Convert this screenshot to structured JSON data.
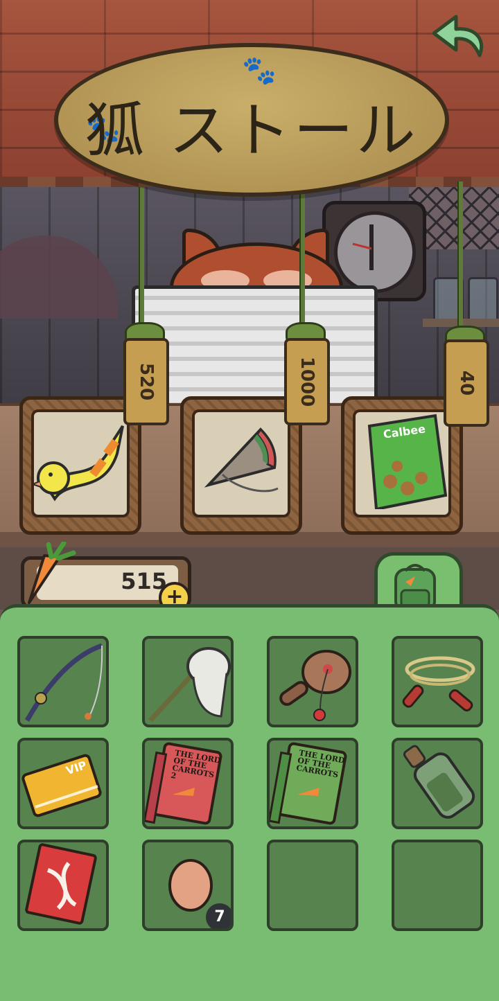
{
  "shop": {
    "sign_title": "狐 ストール",
    "prices": [
      "520",
      "1000",
      "40"
    ],
    "items": [
      {
        "name": "swim ring",
        "icon": "duck-float-icon"
      },
      {
        "name": "spinning top",
        "icon": "spinning-top-icon"
      },
      {
        "name": "snack bag",
        "icon": "snack-bag-icon",
        "brand": "Calbee"
      }
    ]
  },
  "wallet": {
    "carrots": "515",
    "plus": "+"
  },
  "inventory": {
    "slots": [
      {
        "icon": "fishing-rod-icon"
      },
      {
        "icon": "bug-net-icon"
      },
      {
        "icon": "paddle-ball-icon"
      },
      {
        "icon": "jump-rope-icon"
      },
      {
        "icon": "vip-ticket-icon",
        "text": "VIP"
      },
      {
        "icon": "book-icon",
        "text": "THE LORD OF THE CARROTS 2"
      },
      {
        "icon": "book-icon",
        "text": "THE LORD OF THE CARROTS"
      },
      {
        "icon": "bottle-icon"
      },
      {
        "icon": "seed-packet-icon"
      },
      {
        "icon": "egg-icon",
        "count": "7"
      },
      {
        "icon": "empty"
      },
      {
        "icon": "empty"
      }
    ]
  },
  "colors": {
    "panel_green": "#78bd72",
    "slot_green": "#57834e",
    "roof": "#9a4a35",
    "accent_yellow": "#f3cf4a"
  }
}
